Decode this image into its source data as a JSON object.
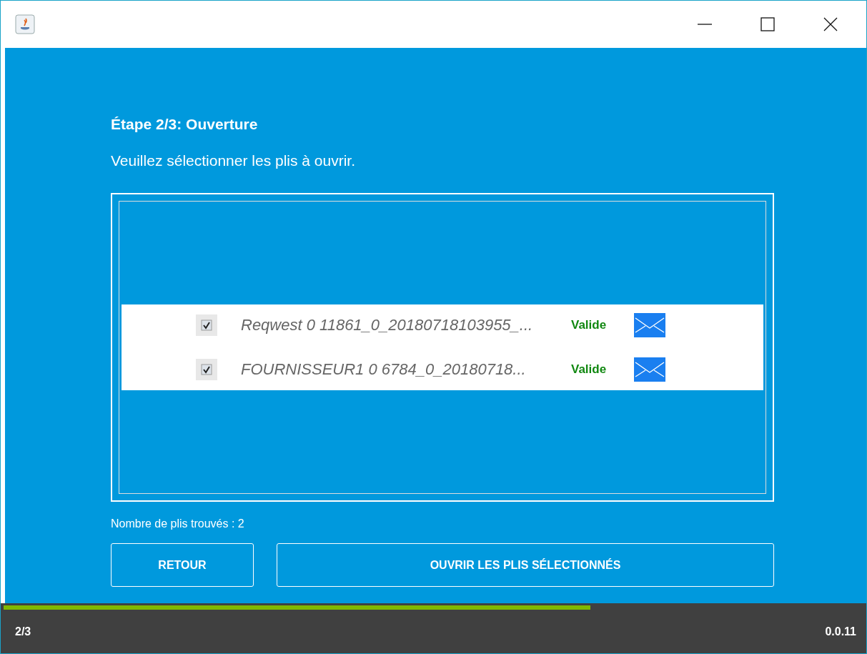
{
  "step_title": "Étape 2/3: Ouverture",
  "instruction": "Veuillez sélectionner les plis à ouvrir.",
  "plis": [
    {
      "name": "Reqwest 0 11861_0_20180718103955_...",
      "checked": true,
      "status": "Valide"
    },
    {
      "name": "FOURNISSEUR1 0 6784_0_20180718...",
      "checked": true,
      "status": "Valide"
    }
  ],
  "count": "Nombre de plis trouvés : 2",
  "buttons": [
    {
      "label": "RETOUR",
      "kind": "back"
    },
    {
      "label": "OUVRIR LES PLIS SÉLECTIONNÉS",
      "kind": "open"
    }
  ],
  "progress": {
    "level": 0.68
  },
  "status_bar": {
    "step": "2/3",
    "version": "0.0.11"
  }
}
